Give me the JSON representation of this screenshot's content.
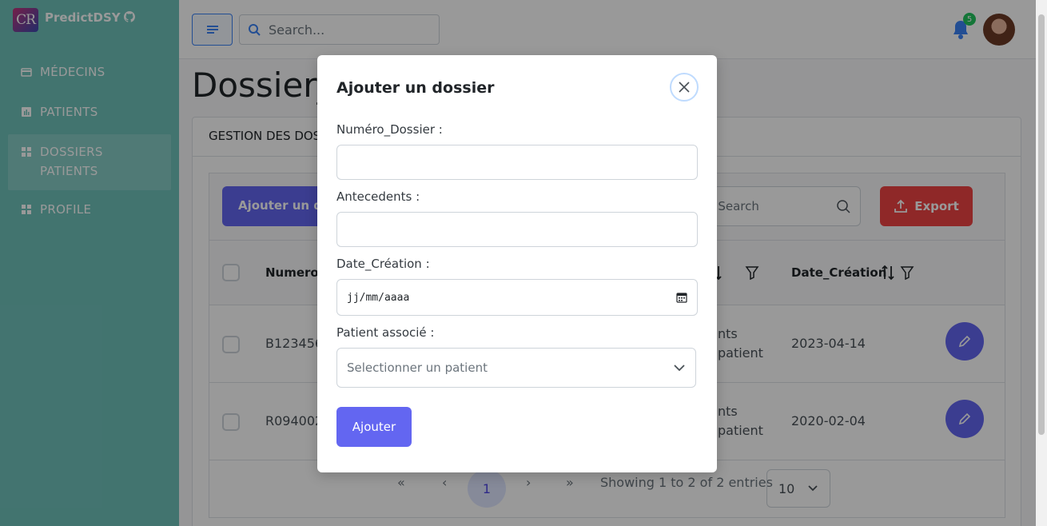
{
  "sidebar": {
    "logo_text": "CR",
    "brand": "PredictDSY",
    "items": [
      {
        "label": "MÉDECINS",
        "icon": "card-icon"
      },
      {
        "label": "PATIENTS",
        "icon": "chart-icon"
      },
      {
        "label": "DOSSIERS PATIENTS",
        "icon": "grid-icon",
        "active": true
      },
      {
        "label": "PROFILE",
        "icon": "grid-icon"
      }
    ]
  },
  "topbar": {
    "search_placeholder": "Search...",
    "notification_count": "5"
  },
  "main": {
    "page_title": "Dossier_",
    "card_header": "GESTION DES DOS",
    "add_button": "Ajouter un do",
    "keyword_search_placeholder": "ord Search",
    "export_button": "Export",
    "columns": [
      "Numero_",
      "Date_Création"
    ],
    "rows": [
      {
        "numero": "B123456",
        "antecedents_line1": "nts",
        "antecedents_line2": "patient",
        "date": "2023-04-14"
      },
      {
        "numero": "R094002",
        "antecedents_line1": "nts",
        "antecedents_line2": "patient",
        "date": "2020-02-04"
      }
    ],
    "pager": {
      "first": "«",
      "prev": "‹",
      "current": "1",
      "next": "›",
      "last": "»",
      "summary": "Showing 1 to 2 of 2 entries",
      "rows_per_page": "10"
    }
  },
  "modal": {
    "title": "Ajouter un dossier",
    "fields": {
      "numero_label": "Numéro_Dossier :",
      "numero_value": "",
      "antecedents_label": "Antecedents :",
      "antecedents_value": "",
      "date_label": "Date_Création :",
      "date_placeholder": "jj/mm/aaaa",
      "patient_label": "Patient associé :",
      "patient_placeholder": "Selectionner un patient"
    },
    "submit_label": "Ajouter"
  },
  "colors": {
    "sidebar": "#6fc2ba",
    "primary": "#6366f1",
    "danger": "#ef4444",
    "badge": "#22c55e"
  }
}
